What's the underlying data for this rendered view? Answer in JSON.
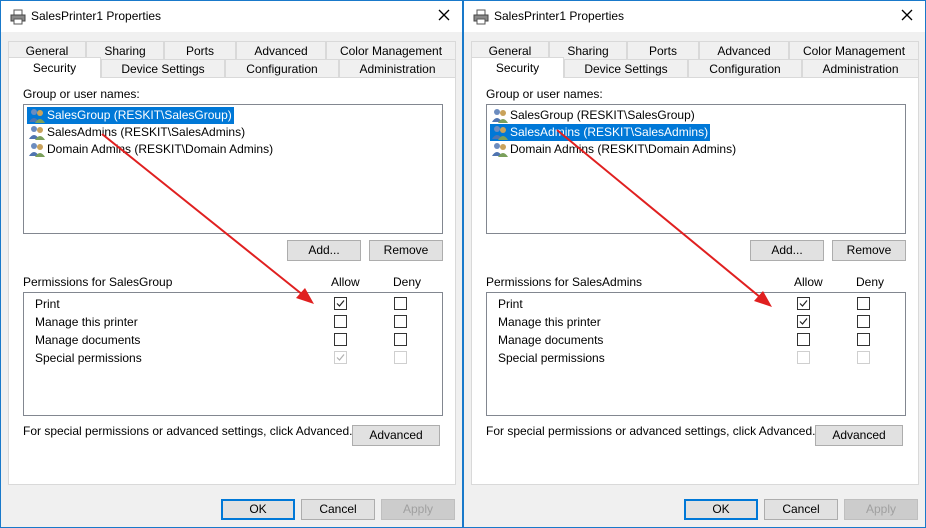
{
  "colors": {
    "accent": "#0078d7",
    "annotation_arrow": "#e02020",
    "window_border": "#1979ca"
  },
  "dialogs": [
    {
      "title": "SalesPrinter1 Properties",
      "tabs_top": [
        "General",
        "Sharing",
        "Ports",
        "Advanced",
        "Color Management"
      ],
      "tabs_bottom": [
        "Security",
        "Device Settings",
        "Configuration",
        "Administration"
      ],
      "active_tab": "Security",
      "group_label": "Group or user names:",
      "users": [
        {
          "name": "SalesGroup (RESKIT\\SalesGroup)",
          "selected": true
        },
        {
          "name": "SalesAdmins (RESKIT\\SalesAdmins)",
          "selected": false
        },
        {
          "name": "Domain Admins (RESKIT\\Domain Admins)",
          "selected": false
        }
      ],
      "add_label": "Add...",
      "remove_label": "Remove",
      "permissions_label": "Permissions for SalesGroup",
      "allow_label": "Allow",
      "deny_label": "Deny",
      "permissions": [
        {
          "name": "Print",
          "allow": true,
          "allow_disabled": false,
          "deny": false,
          "deny_disabled": false
        },
        {
          "name": "Manage this printer",
          "allow": false,
          "allow_disabled": false,
          "deny": false,
          "deny_disabled": false
        },
        {
          "name": "Manage documents",
          "allow": false,
          "allow_disabled": false,
          "deny": false,
          "deny_disabled": false
        },
        {
          "name": "Special permissions",
          "allow": true,
          "allow_disabled": true,
          "deny": false,
          "deny_disabled": true
        }
      ],
      "special_text": "For special permissions or advanced settings, click Advanced.",
      "advanced_label": "Advanced",
      "ok_label": "OK",
      "cancel_label": "Cancel",
      "apply_label": "Apply"
    },
    {
      "title": "SalesPrinter1 Properties",
      "tabs_top": [
        "General",
        "Sharing",
        "Ports",
        "Advanced",
        "Color Management"
      ],
      "tabs_bottom": [
        "Security",
        "Device Settings",
        "Configuration",
        "Administration"
      ],
      "active_tab": "Security",
      "group_label": "Group or user names:",
      "users": [
        {
          "name": "SalesGroup (RESKIT\\SalesGroup)",
          "selected": false
        },
        {
          "name": "SalesAdmins (RESKIT\\SalesAdmins)",
          "selected": true
        },
        {
          "name": "Domain Admins (RESKIT\\Domain Admins)",
          "selected": false
        }
      ],
      "add_label": "Add...",
      "remove_label": "Remove",
      "permissions_label": "Permissions for SalesAdmins",
      "allow_label": "Allow",
      "deny_label": "Deny",
      "permissions": [
        {
          "name": "Print",
          "allow": true,
          "allow_disabled": false,
          "deny": false,
          "deny_disabled": false
        },
        {
          "name": "Manage this printer",
          "allow": true,
          "allow_disabled": false,
          "deny": false,
          "deny_disabled": false
        },
        {
          "name": "Manage documents",
          "allow": false,
          "allow_disabled": false,
          "deny": false,
          "deny_disabled": false
        },
        {
          "name": "Special permissions",
          "allow": false,
          "allow_disabled": true,
          "deny": false,
          "deny_disabled": true
        }
      ],
      "special_text": "For special permissions or advanced settings, click Advanced.",
      "advanced_label": "Advanced",
      "ok_label": "OK",
      "cancel_label": "Cancel",
      "apply_label": "Apply"
    }
  ]
}
